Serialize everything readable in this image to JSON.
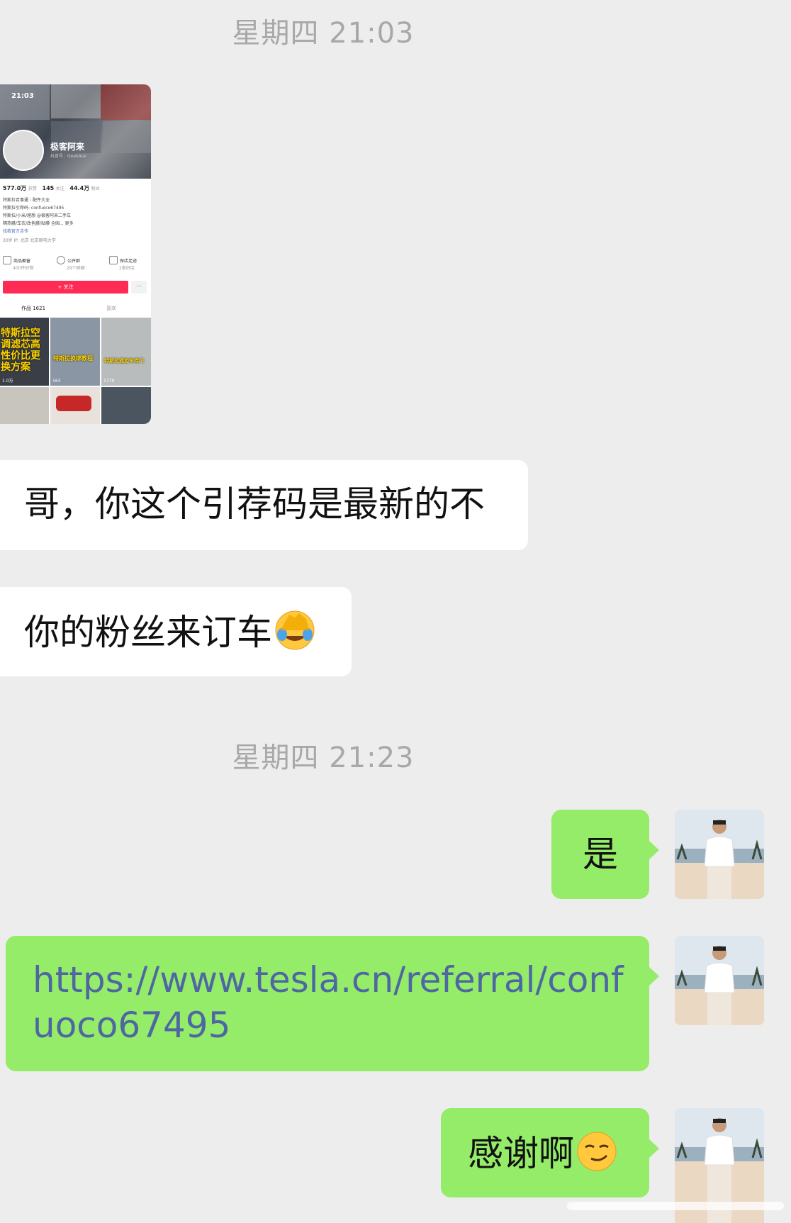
{
  "chat": {
    "timestamp_1": "星期四 21:03",
    "timestamp_2": "星期四 21:23",
    "incoming_1": "哥，你这个引荐码是最新的不",
    "incoming_2": "你的粉丝来订车",
    "outgoing_1": "是",
    "outgoing_2_link": "https://www.tesla.cn/referral/confuoco67495",
    "outgoing_3": "感谢啊"
  },
  "shared_screenshot": {
    "status_time": "21:03",
    "profile_name": "极客阿来",
    "profile_id": "抖音号：GeekAlai",
    "stats": [
      {
        "num": "577.0万",
        "label": "获赞"
      },
      {
        "num": "145",
        "label": "关注"
      },
      {
        "num": "44.4万",
        "label": "粉丝"
      }
    ],
    "bio_lines": [
      "特斯拉百事通｜配件大全",
      "特斯拉引荐码: confuoco67495",
      "特斯拉/小米/理想 @极客阿来二手车",
      "隔热膜/车衣/改色膜/贴膜 全国... 更多"
    ],
    "collab": "找我官方合作",
    "tags": "30岁  IP: 北京  北京邮电大学",
    "shortcuts": [
      "商品橱窗",
      "公开群",
      "探店足迹"
    ],
    "shortcut_subs": [
      "400件好物",
      "29个群聊",
      "2家好店"
    ],
    "follow_label": "+ 关注",
    "more_label": "···",
    "tab_works": "作品 1621",
    "tab_likes": "喜欢",
    "video_texts": [
      "特斯拉空调滤芯高性价比更换方案",
      "特斯拉换绑教程",
      "特斯拉遥控车库门"
    ],
    "video_likes": [
      "1.0万",
      "163",
      "1779"
    ]
  },
  "colors": {
    "background": "#ededed",
    "incoming_bubble": "#ffffff",
    "outgoing_bubble": "#95ec69",
    "timestamp": "#a8a8a8",
    "link": "#4e67a3",
    "follow_button": "#fe2c55"
  },
  "icons": {
    "facepalm_emoji": "face-with-hand-over-eyes-emoji",
    "smirk_emoji": "smirking-face-emoji"
  }
}
